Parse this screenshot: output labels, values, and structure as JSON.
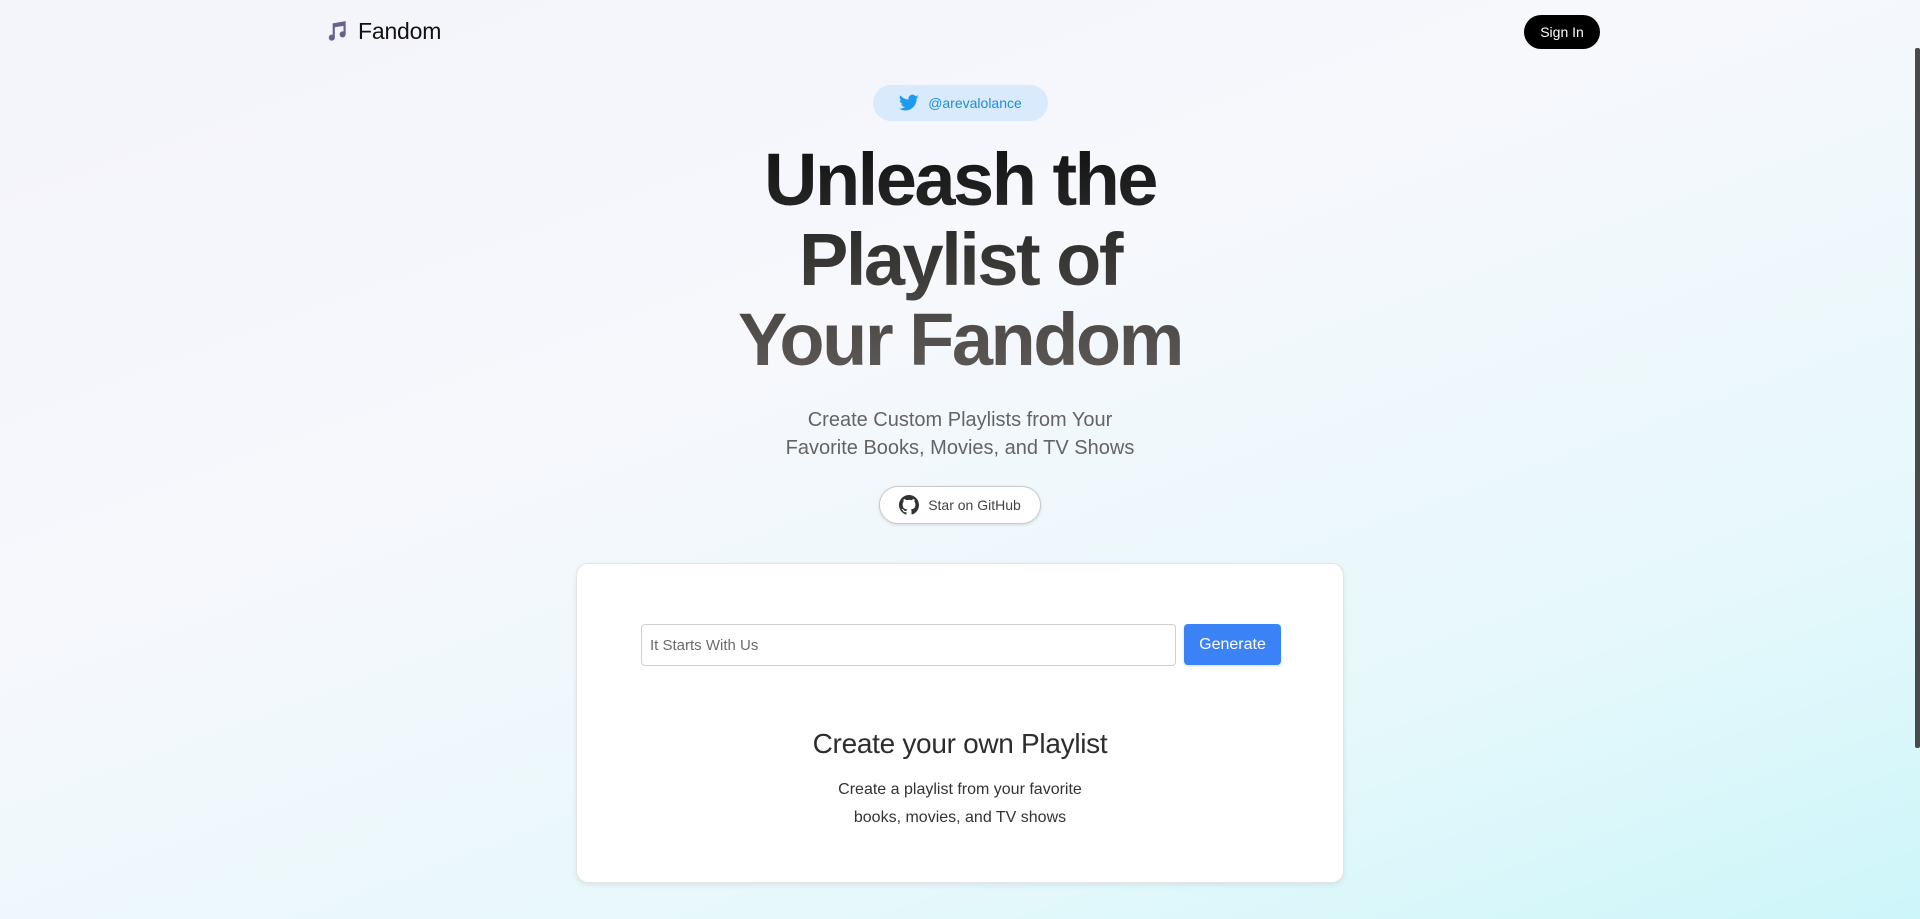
{
  "header": {
    "brand_name": "Fandom",
    "brand_icon": "music-notes-icon",
    "signin_label": "Sign In"
  },
  "twitter": {
    "handle": "@arevalolance",
    "icon": "twitter-bird-icon",
    "color": "#1d8fd6"
  },
  "hero": {
    "line1": "Unleash the",
    "line2": "Playlist of",
    "line3": "Your Fandom"
  },
  "subtitle": {
    "line1": "Create Custom Playlists from Your",
    "line2": "Favorite Books, Movies, and TV Shows"
  },
  "github": {
    "label": "Star on GitHub",
    "icon": "github-icon"
  },
  "generator": {
    "input_placeholder": "It Starts With Us",
    "input_value": "",
    "generate_label": "Generate",
    "accent": "#3b82f6"
  },
  "card": {
    "title": "Create your own Playlist",
    "text_line1": "Create a playlist from your favorite",
    "text_line2": "books, movies, and TV shows"
  }
}
